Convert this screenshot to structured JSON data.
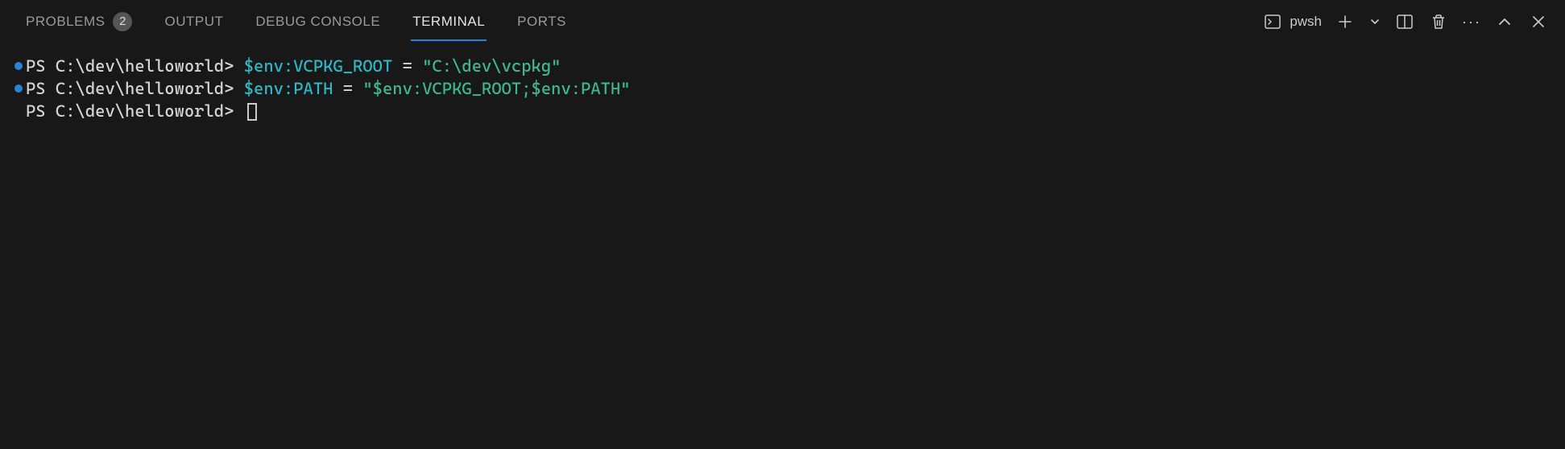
{
  "tabs": {
    "problems": {
      "label": "PROBLEMS",
      "badge": "2"
    },
    "output": {
      "label": "OUTPUT"
    },
    "debug": {
      "label": "DEBUG CONSOLE"
    },
    "terminal": {
      "label": "TERMINAL"
    },
    "ports": {
      "label": "PORTS"
    }
  },
  "shell": {
    "name": "pwsh"
  },
  "terminal": {
    "prompt": "PS C:\\dev\\helloworld> ",
    "lines": [
      {
        "marker": true,
        "segments": [
          {
            "cls": "cyan",
            "text": "$env:VCPKG_ROOT "
          },
          {
            "cls": "prompt",
            "text": "= "
          },
          {
            "cls": "teal",
            "text": "\"C:\\dev\\vcpkg\""
          }
        ]
      },
      {
        "marker": true,
        "segments": [
          {
            "cls": "cyan",
            "text": "$env:PATH "
          },
          {
            "cls": "prompt",
            "text": "= "
          },
          {
            "cls": "teal",
            "text": "\"$env:VCPKG_ROOT;$env:PATH\""
          }
        ]
      },
      {
        "marker": false,
        "cursor": true,
        "segments": []
      }
    ]
  }
}
